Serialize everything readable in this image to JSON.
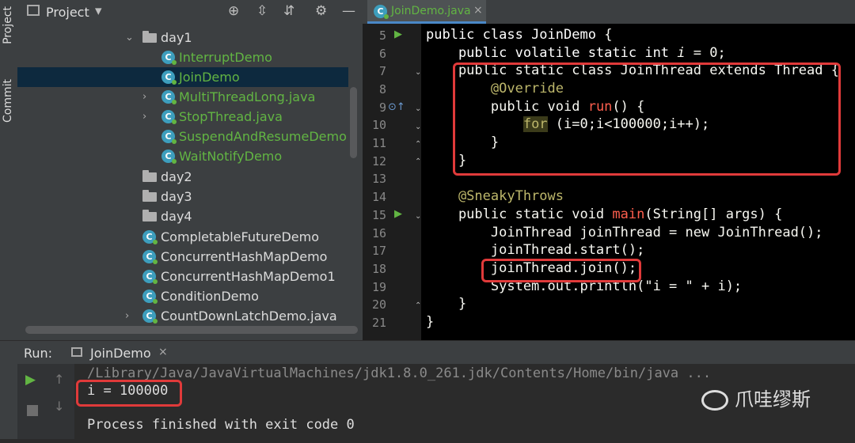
{
  "left_strip": {
    "project_label": "Project",
    "commit_label": "Commit"
  },
  "project_panel": {
    "title": "Project",
    "tree": [
      {
        "label": "day1",
        "type": "folder",
        "expanded": true
      },
      {
        "label": "InterruptDemo",
        "type": "class"
      },
      {
        "label": "JoinDemo",
        "type": "class",
        "selected": true
      },
      {
        "label": "MultiThreadLong.java",
        "type": "class"
      },
      {
        "label": "StopThread.java",
        "type": "class"
      },
      {
        "label": "SuspendAndResumeDemo",
        "type": "class"
      },
      {
        "label": "WaitNotifyDemo",
        "type": "class"
      },
      {
        "label": "day2",
        "type": "folder"
      },
      {
        "label": "day3",
        "type": "folder"
      },
      {
        "label": "day4",
        "type": "folder"
      },
      {
        "label": "CompletableFutureDemo",
        "type": "class"
      },
      {
        "label": "ConcurrentHashMapDemo",
        "type": "class"
      },
      {
        "label": "ConcurrentHashMapDemo1",
        "type": "class"
      },
      {
        "label": "ConditionDemo",
        "type": "class"
      },
      {
        "label": "CountDownLatchDemo.java",
        "type": "class"
      }
    ]
  },
  "editor": {
    "tab_label": "JoinDemo.java",
    "line_numbers": [
      "5",
      "6",
      "7",
      "8",
      "9",
      "10",
      "11",
      "12",
      "13",
      "14",
      "15",
      "16",
      "17",
      "18",
      "19",
      "20",
      "21"
    ],
    "lines": {
      "l5": {
        "a": "public class ",
        "b": "JoinDemo",
        "c": " {"
      },
      "l6": {
        "a": "    public volatile static int ",
        "b": "i",
        "c": " = 0;"
      },
      "l7": {
        "a": "    public static class JoinThread extends Thread {"
      },
      "l8": {
        "a": "        @Override"
      },
      "l9": {
        "a": "        public void ",
        "b": "run",
        "c": "() {"
      },
      "l10": {
        "pre": "            ",
        "for": "for",
        "rest": " (i=0;i<100000;i++);"
      },
      "l11": {
        "a": "        }"
      },
      "l12": {
        "a": "    }"
      },
      "l14": {
        "a": "    @SneakyThrows"
      },
      "l15": {
        "a": "    public static void ",
        "b": "main",
        "c": "(String[] args) {"
      },
      "l16": {
        "a": "        JoinThread joinThread = new JoinThread();"
      },
      "l17": {
        "a": "        joinThread.start();"
      },
      "l18": {
        "a": "        joinThread.join();"
      },
      "l19": {
        "a": "        System.out.println(\"i = \" + i);"
      },
      "l20": {
        "a": "    }"
      },
      "l21": {
        "a": "}"
      }
    }
  },
  "run_panel": {
    "label": "Run:",
    "tab_label": "JoinDemo",
    "console": [
      "/Library/Java/JavaVirtualMachines/jdk1.8.0_261.jdk/Contents/Home/bin/java ...",
      "i = 100000",
      "",
      "Process finished with exit code 0"
    ]
  },
  "watermark": "爪哇缪斯",
  "colors": {
    "highlight_box": "#e03a3a",
    "selection": "#0d293e",
    "class_green": "#62b543"
  }
}
